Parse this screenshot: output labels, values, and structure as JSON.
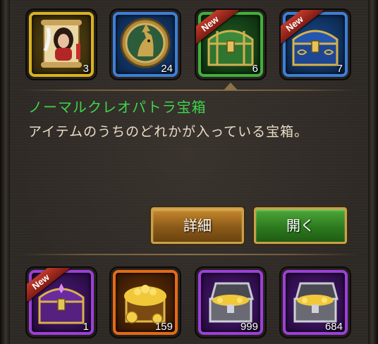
{
  "top_items": [
    {
      "count": "3",
      "badge": "",
      "frame": "gold",
      "icon": "cleopatra-scroll-icon"
    },
    {
      "count": "24",
      "badge": "",
      "frame": "blue",
      "icon": "bronze-medallion-icon"
    },
    {
      "count": "6",
      "badge": "New",
      "frame": "green",
      "icon": "green-treasure-chest-icon"
    },
    {
      "count": "7",
      "badge": "New",
      "frame": "blue",
      "icon": "blue-treasure-chest-icon"
    }
  ],
  "selected_item": {
    "name": "ノーマルクレオパトラ宝箱",
    "description": "アイテムのうちのどれかが入っている宝箱。"
  },
  "buttons": {
    "detail": "詳細",
    "open": "開く"
  },
  "bottom_items": [
    {
      "count": "1",
      "badge": "New",
      "frame": "purple",
      "icon": "purple-treasure-chest-icon"
    },
    {
      "count": "159",
      "badge": "",
      "frame": "orange",
      "icon": "gold-treasure-pile-icon"
    },
    {
      "count": "999",
      "badge": "",
      "frame": "purple",
      "icon": "silver-gold-chest-icon"
    },
    {
      "count": "684",
      "badge": "",
      "frame": "purple",
      "icon": "silver-gold-chest-icon"
    }
  ],
  "colors": {
    "title_green": "#3dd64a",
    "description": "#e7dcc6",
    "gold_frame": "#d9b220",
    "blue_frame": "#3d7fd6",
    "green_frame": "#42b03a",
    "orange_frame": "#e46a16",
    "purple_frame": "#9d3fd8",
    "new_ribbon": "#c03a2a"
  }
}
